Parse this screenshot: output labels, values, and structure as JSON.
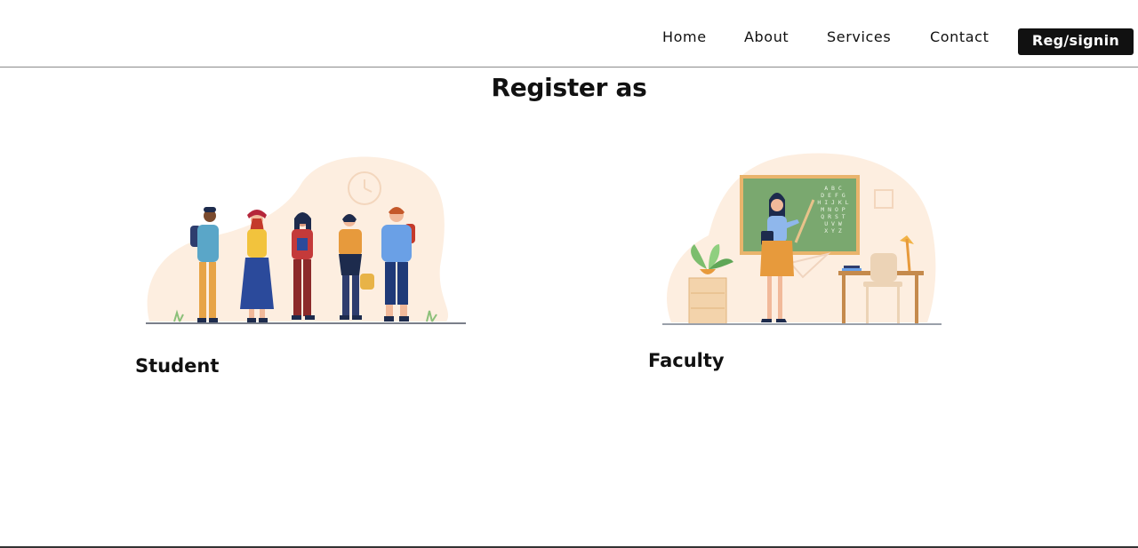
{
  "nav": {
    "links": [
      "Home",
      "About",
      "Services",
      "Contact"
    ],
    "cta": "Reg/signin"
  },
  "main": {
    "title": "Register as",
    "options": [
      {
        "label": "Student",
        "illustration": "students-group-illustration"
      },
      {
        "label": "Faculty",
        "illustration": "teacher-classroom-illustration"
      }
    ],
    "chalkboard_letters": [
      "A B C",
      "D E F G",
      "H I J K L",
      "M N O P",
      "Q R S T",
      "U V W",
      "X Y Z"
    ]
  },
  "colors": {
    "text": "#111111",
    "cta_bg": "#111111",
    "cta_text": "#ffffff",
    "blob": "#fdeee0",
    "chalkboard": "#7aa86f"
  }
}
